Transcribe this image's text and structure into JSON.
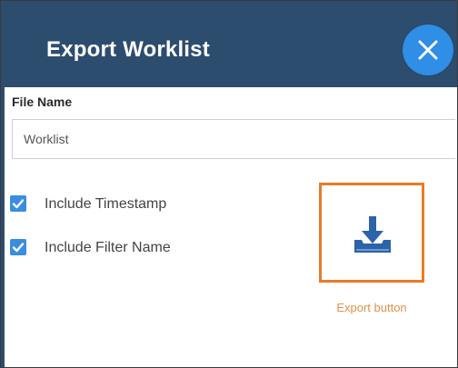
{
  "dialog": {
    "title": "Export Worklist",
    "close_icon": "close-icon"
  },
  "file_name": {
    "label": "File Name",
    "value": "Worklist"
  },
  "options": [
    {
      "label": "Include Timestamp",
      "checked": true
    },
    {
      "label": "Include Filter Name",
      "checked": true
    }
  ],
  "export": {
    "icon": "download-tray-icon",
    "caption": "Export button"
  },
  "colors": {
    "header": "#2d4d6f",
    "close_button": "#2f8ee6",
    "checkbox": "#3a8ee0",
    "highlight": "#ea7b26",
    "export_icon": "#2d63a8"
  }
}
